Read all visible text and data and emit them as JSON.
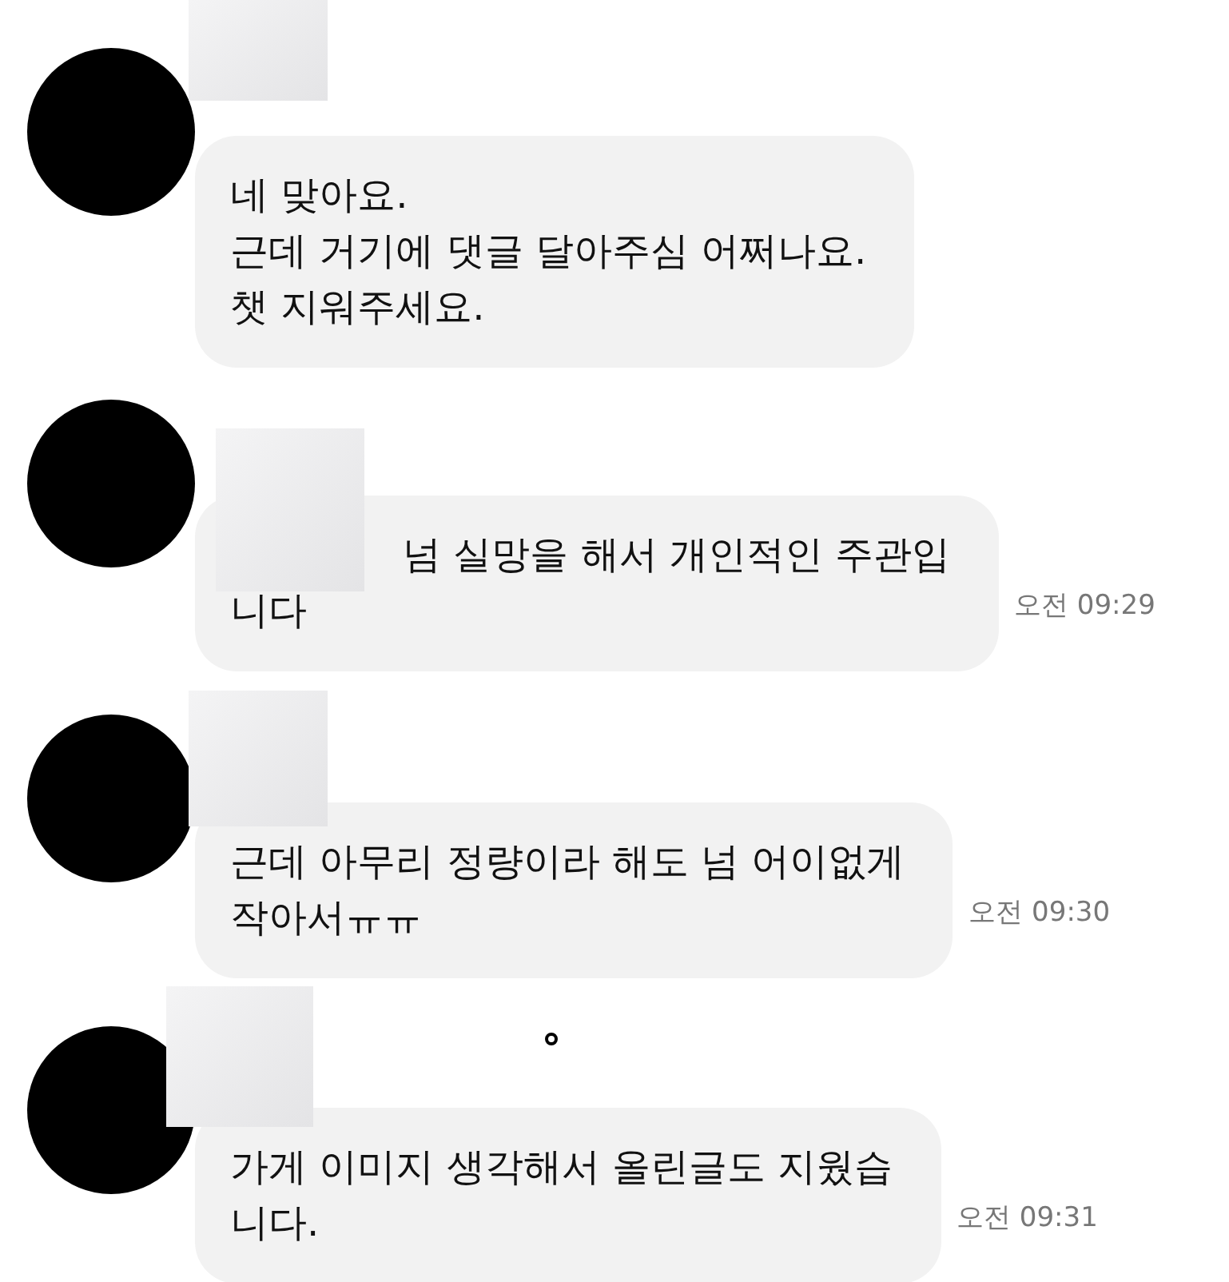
{
  "messages": [
    {
      "kind": "plain",
      "text": "네 맞아요.\n근데 거기에 댓글 달아주심 어쩌나요.\n챗 지워주세요."
    },
    {
      "kind": "overlapped",
      "text": "넘 실망을 해서 개인적인 주관입\n니다",
      "time": "오전 09:29"
    },
    {
      "kind": "plain",
      "text": "근데 아무리 정량이라 해도 넘 어이없게\n작아서ㅠㅠ",
      "time": "오전 09:30"
    },
    {
      "kind": "plain",
      "text": "가게 이미지 생각해서 올린글도 지웠습\n니다.",
      "time": "오전 09:31"
    }
  ]
}
